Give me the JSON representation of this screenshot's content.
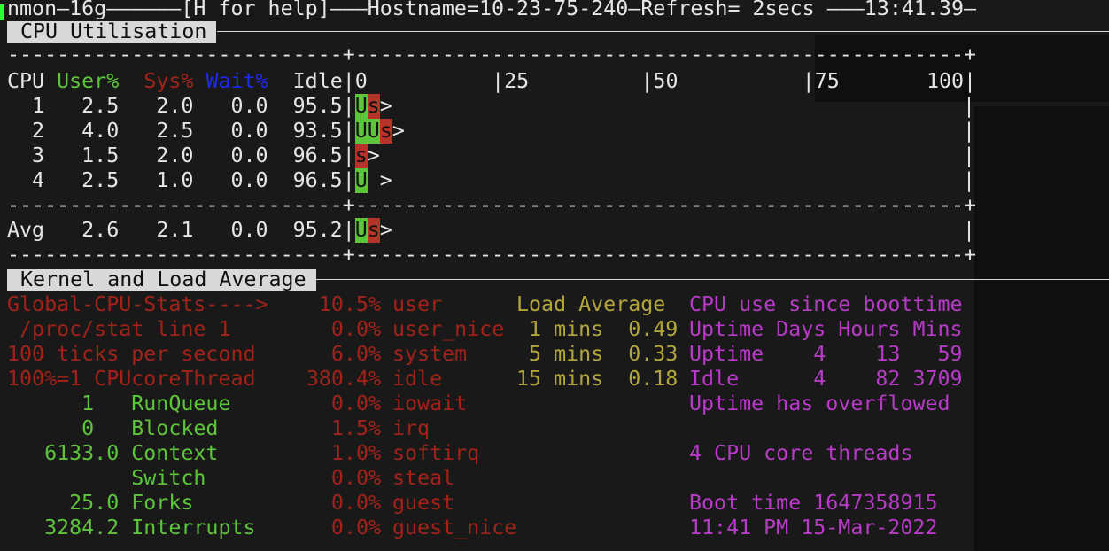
{
  "header": {
    "line": "nmon—16g——————[H for help]———Hostname=10-23-75-240—Refresh= 2secs ———13:41.39—"
  },
  "cpu_section": {
    "title": "CPU Utilisation",
    "sep": "---------------------------+-------------------------------------------------+",
    "headers": {
      "cpu": "CPU",
      "user": "User%",
      "sys": "Sys%",
      "wait": "Wait%",
      "idle": "Idle"
    },
    "scale": "|0          |25         |50          |75       100|",
    "rows": [
      {
        "cpu": "  1",
        "user": "2.5",
        "sys": "2.0",
        "wait": "0.0",
        "idle": "95.5",
        "bar_u": "U",
        "bar_s": "s",
        "tail": ">"
      },
      {
        "cpu": "  2",
        "user": "4.0",
        "sys": "2.5",
        "wait": "0.0",
        "idle": "93.5",
        "bar_u": "UU",
        "bar_s": "s",
        "tail": ">"
      },
      {
        "cpu": "  3",
        "user": "1.5",
        "sys": "2.0",
        "wait": "0.0",
        "idle": "96.5",
        "bar_u": "",
        "bar_s": "s",
        "tail": ">"
      },
      {
        "cpu": "  4",
        "user": "2.5",
        "sys": "1.0",
        "wait": "0.0",
        "idle": "96.5",
        "bar_u": "U",
        "bar_s": "",
        "tail": " >"
      }
    ],
    "avg": {
      "cpu": "Avg",
      "user": "2.6",
      "sys": "2.1",
      "wait": "0.0",
      "idle": "95.2",
      "bar_u": "U",
      "bar_s": "s",
      "tail": ">"
    }
  },
  "kernel_section": {
    "title": "Kernel and Load Average",
    "rows": [
      {
        "left": "Global-CPU-Stats---->",
        "left_color": "red",
        "pct": "10.5%",
        "stat": "user",
        "load": "Load Average",
        "boot": "CPU use since boottime"
      },
      {
        "left": " /proc/stat line 1",
        "left_color": "red",
        "pct": "0.0%",
        "stat": "user_nice",
        "load": " 1 mins  0.49",
        "boot": "Uptime Days Hours Mins"
      },
      {
        "left": "100 ticks per second",
        "left_color": "red",
        "pct": "6.0%",
        "stat": "system",
        "load": " 5 mins  0.33",
        "boot": "Uptime    4    13   59"
      },
      {
        "left": "100%=1 CPUcoreThread",
        "left_color": "red",
        "pct": "380.4%",
        "stat": "idle",
        "load": "15 mins  0.18",
        "boot": "Idle      4    82 3709"
      },
      {
        "left": "      1   RunQueue",
        "left_color": "green",
        "pct": "0.0%",
        "stat": "iowait",
        "load": "",
        "boot": "Uptime has overflowed"
      },
      {
        "left": "      0   Blocked",
        "left_color": "green",
        "pct": "1.5%",
        "stat": "irq",
        "load": "",
        "boot": ""
      },
      {
        "left": "   6133.0 Context",
        "left_color": "green",
        "pct": "1.0%",
        "stat": "softirq",
        "load": "",
        "boot": "4 CPU core threads"
      },
      {
        "left": "          Switch",
        "left_color": "green",
        "pct": "0.0%",
        "stat": "steal",
        "load": "",
        "boot": ""
      },
      {
        "left": "     25.0 Forks",
        "left_color": "green",
        "pct": "0.0%",
        "stat": "guest",
        "load": "",
        "boot": "Boot time 1647358915"
      },
      {
        "left": "   3284.2 Interrupts",
        "left_color": "green",
        "pct": "0.0%",
        "stat": "guest_nice",
        "load": "",
        "boot": "11:41 PM 15-Mar-2022"
      }
    ]
  },
  "colors": {
    "green": "#5ec43c",
    "red": "#a0231a",
    "blue": "#1d2ae8",
    "yellow": "#b2a63a",
    "magenta": "#b83bc8",
    "bg": "#191919"
  }
}
